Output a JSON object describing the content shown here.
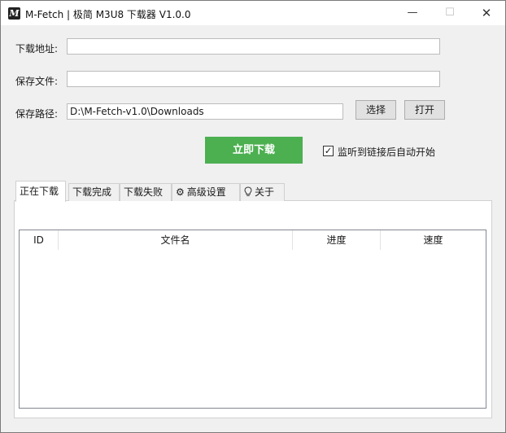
{
  "window": {
    "icon_letter": "M",
    "title": "M-Fetch | 极简 M3U8 下载器 V1.0.0",
    "min_glyph": "—",
    "max_glyph": "☐",
    "close_glyph": "✕"
  },
  "form": {
    "url_label": "下载地址:",
    "url_value": "",
    "file_label": "保存文件:",
    "file_value": "",
    "path_label": "保存路径:",
    "path_value": "D:\\M-Fetch-v1.0\\Downloads",
    "choose_label": "选择",
    "open_label": "打开",
    "download_label": "立即下载",
    "auto_check_glyph": "✓",
    "auto_checked": true,
    "auto_label": "监听到链接后自动开始"
  },
  "tabs": [
    {
      "label": "正在下载",
      "icon": ""
    },
    {
      "label": "下载完成",
      "icon": ""
    },
    {
      "label": "下载失败",
      "icon": ""
    },
    {
      "label": "高级设置",
      "icon": "gear-icon",
      "glyph": "⚙"
    },
    {
      "label": "关于",
      "icon": "lightbulb-icon",
      "glyph": "💡"
    }
  ],
  "active_tab": 0,
  "table": {
    "columns": [
      "ID",
      "文件名",
      "进度",
      "速度"
    ],
    "rows": []
  },
  "colors": {
    "accent": "#4caf50",
    "window_bg": "#f0f0f0"
  }
}
